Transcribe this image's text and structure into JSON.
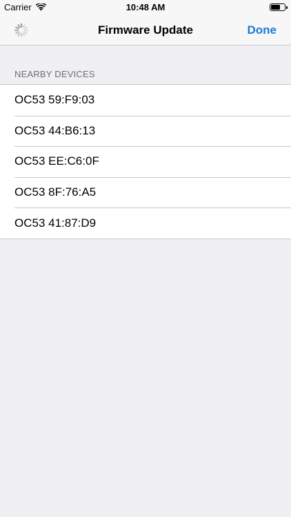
{
  "status_bar": {
    "carrier": "Carrier",
    "time": "10:48 AM"
  },
  "nav": {
    "title": "Firmware Update",
    "done_label": "Done",
    "accent_color": "#1a7ad6"
  },
  "section": {
    "header": "NEARBY DEVICES"
  },
  "devices": [
    {
      "label": "OC53 59:F9:03"
    },
    {
      "label": "OC53 44:B6:13"
    },
    {
      "label": "OC53 EE:C6:0F"
    },
    {
      "label": "OC53 8F:76:A5"
    },
    {
      "label": "OC53 41:87:D9"
    }
  ],
  "icons": {
    "wifi": "wifi-icon",
    "battery": "battery-icon",
    "spinner": "activity-spinner-icon"
  }
}
